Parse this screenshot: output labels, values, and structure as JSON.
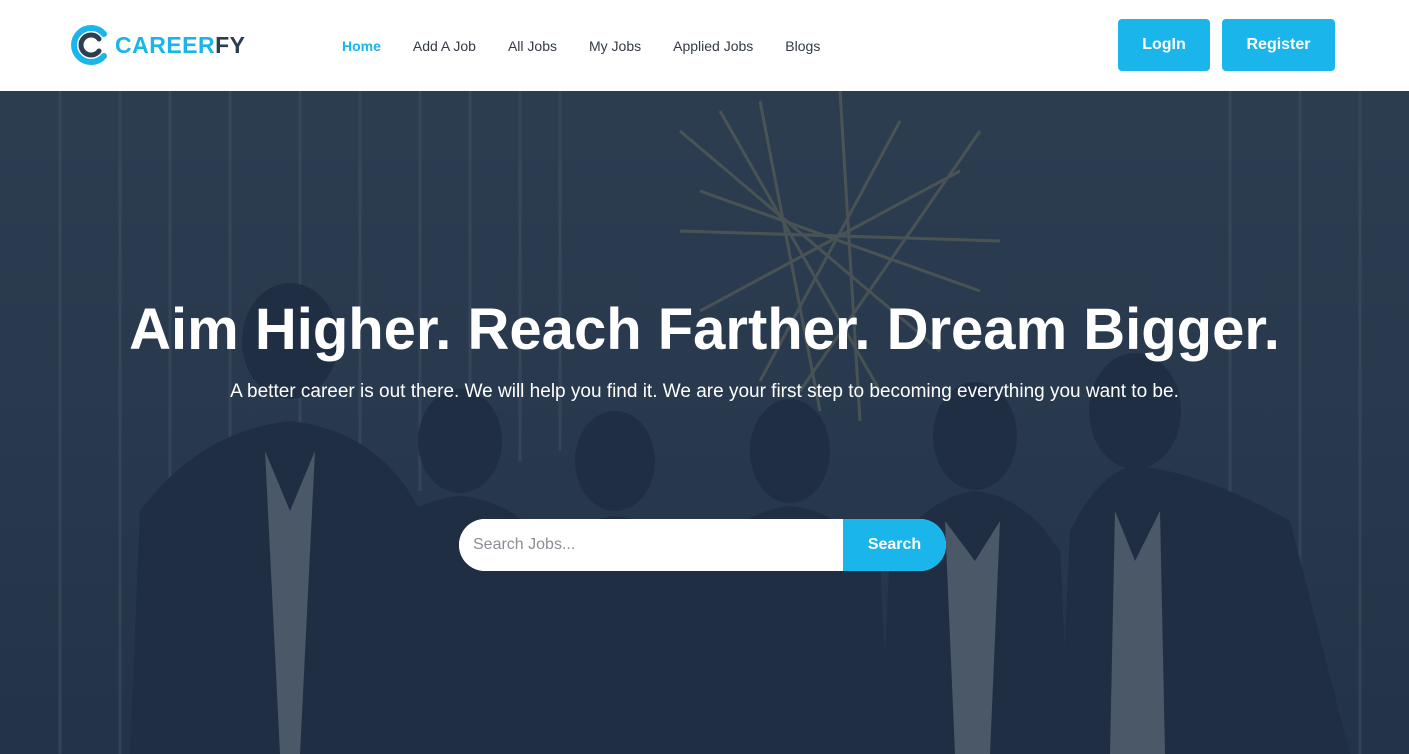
{
  "brand": {
    "name_part_a": "CAREER",
    "name_part_b": "FY",
    "accent_color": "#1ab5ea",
    "dark_color": "#2c3e50"
  },
  "nav": {
    "items": [
      {
        "label": "Home",
        "active": true
      },
      {
        "label": "Add A Job",
        "active": false
      },
      {
        "label": "All Jobs",
        "active": false
      },
      {
        "label": "My Jobs",
        "active": false
      },
      {
        "label": "Applied Jobs",
        "active": false
      },
      {
        "label": "Blogs",
        "active": false
      }
    ]
  },
  "auth": {
    "login_label": "LogIn",
    "register_label": "Register"
  },
  "hero": {
    "title": "Aim Higher. Reach Farther. Dream Bigger.",
    "subtitle": "A better career is out there. We will help you find it. We are your first step to becoming everything you want to be.",
    "search": {
      "placeholder": "Search Jobs...",
      "value": "",
      "button_label": "Search"
    }
  }
}
